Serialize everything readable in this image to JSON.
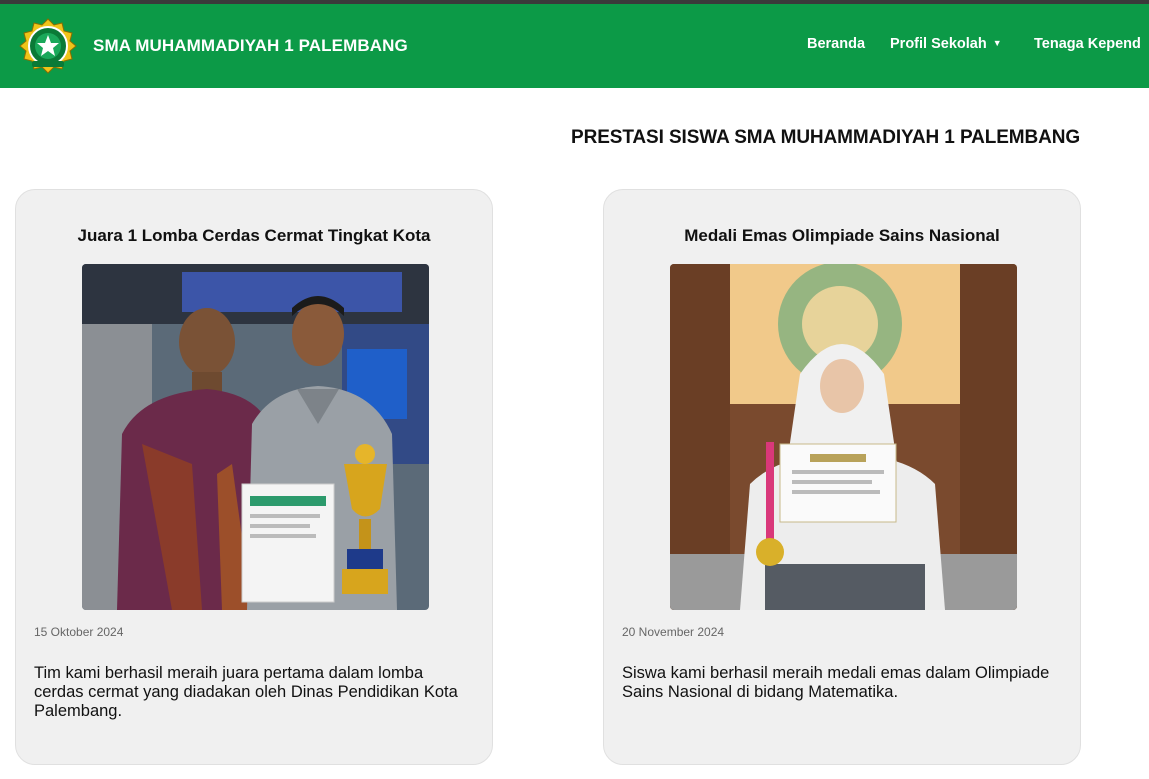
{
  "header": {
    "brand": "SMA MUHAMMADIYAH 1 PALEMBANG",
    "logo_icon": "school-emblem-icon",
    "nav": [
      {
        "label": "Beranda",
        "has_dropdown": false
      },
      {
        "label": "Profil Sekolah",
        "has_dropdown": true
      },
      {
        "label": "Tenaga Kepend",
        "has_dropdown": false
      }
    ],
    "dropdown_glyph": "▼"
  },
  "main": {
    "title": "PRESTASI SISWA SMA MUHAMMADIYAH 1 PALEMBANG",
    "cards": [
      {
        "title": "Juara 1 Lomba Cerdas Cermat Tingkat Kota",
        "date": "15 Oktober 2024",
        "description": "Tim kami berhasil meraih juara pertama dalam lomba cerdas cermat yang diadakan oleh Dinas Pendidikan Kota Palembang."
      },
      {
        "title": "Medali Emas Olimpiade Sains Nasional",
        "date": "20 November 2024",
        "description": "Siswa kami berhasil meraih medali emas dalam Olimpiade Sains Nasional di bidang Matematika."
      }
    ]
  },
  "colors": {
    "navbar": "#0c9a47",
    "card_bg": "#f0f0f0",
    "text": "#111111"
  }
}
